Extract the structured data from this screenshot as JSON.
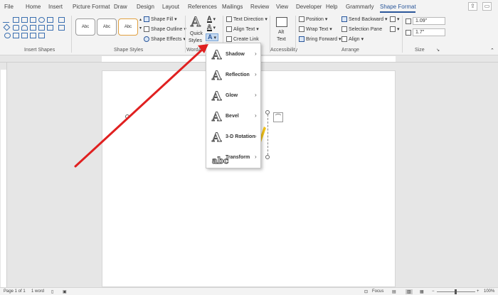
{
  "tabs": [
    "File",
    "Home",
    "Insert",
    "Picture Format",
    "Draw",
    "Design",
    "Layout",
    "References",
    "Mailings",
    "Review",
    "View",
    "Developer",
    "Help",
    "Grammarly",
    "Shape Format"
  ],
  "active_tab": "Shape Format",
  "ribbon": {
    "insert_shapes": {
      "label": "Insert Shapes"
    },
    "shape_styles": {
      "label": "Shape Styles",
      "style_sample": "Abc",
      "fill": "Shape Fill",
      "outline": "Shape Outline",
      "effects": "Shape Effects"
    },
    "wordart": {
      "quick_styles_1": "Quick",
      "quick_styles_2": "Styles",
      "group_label_partial": "WordArt S"
    },
    "text": {
      "direction": "Text Direction",
      "align": "Align Text",
      "link": "Create Link"
    },
    "accessibility": {
      "alt_text_1": "Alt",
      "alt_text_2": "Text",
      "label": "Accessibility"
    },
    "arrange": {
      "position": "Position",
      "wrap": "Wrap Text",
      "bring_forward": "Bring Forward",
      "send_backward": "Send Backward",
      "selection_pane": "Selection Pane",
      "align": "Align",
      "label": "Arrange"
    },
    "size": {
      "height": "1.09\"",
      "width": "1.7\"",
      "label": "Size"
    }
  },
  "text_effects_menu": [
    {
      "label": "Shadow"
    },
    {
      "label": "Reflection"
    },
    {
      "label": "Glow"
    },
    {
      "label": "Bevel"
    },
    {
      "label": "3-D Rotation"
    },
    {
      "label": "Transform"
    }
  ],
  "status": {
    "page": "Page 1 of 1",
    "words": "1 word",
    "focus": "Focus",
    "zoom": "100%"
  },
  "colors": {
    "accent": "#2b579a",
    "arrow": "#e02020",
    "highlight": "#f5c518"
  }
}
